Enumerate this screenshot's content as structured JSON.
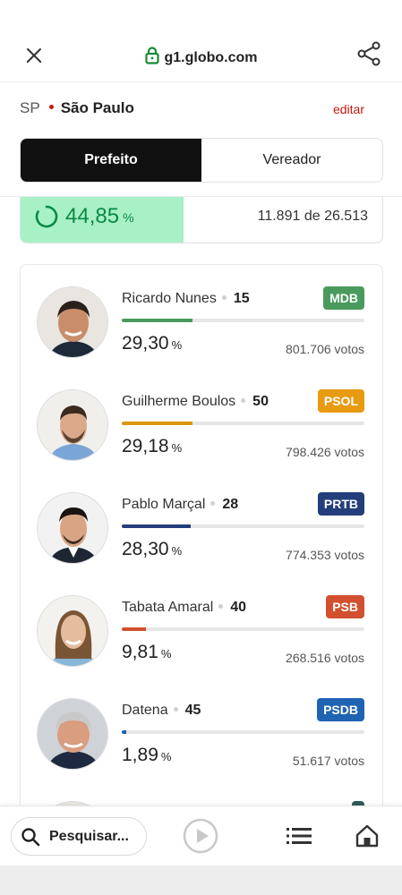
{
  "browser": {
    "url": "g1.globo.com"
  },
  "location": {
    "state": "SP",
    "city": "São Paulo",
    "edit_label": "editar"
  },
  "tabs": [
    {
      "label": "Prefeito",
      "active": true
    },
    {
      "label": "Vereador",
      "active": false
    }
  ],
  "apuracao": {
    "percent": "44,85",
    "percent_unit": "%",
    "progress_fraction": 0.4485,
    "sections": "11.891 de 26.513"
  },
  "candidates": [
    {
      "name": "Ricardo Nunes",
      "number": "15",
      "party": "MDB",
      "party_color": "#4a9a5e",
      "percent": "29,30",
      "unit": "%",
      "votes": "801.706 votos",
      "share": 0.293,
      "bar_color": "#4a9a5e"
    },
    {
      "name": "Guilherme Boulos",
      "number": "50",
      "party": "PSOL",
      "party_color": "#e89a10",
      "percent": "29,18",
      "unit": "%",
      "votes": "798.426 votos",
      "share": 0.2918,
      "bar_color": "#d9960f"
    },
    {
      "name": "Pablo Marçal",
      "number": "28",
      "party": "PRTB",
      "party_color": "#233e7a",
      "percent": "28,30",
      "unit": "%",
      "votes": "774.353 votos",
      "share": 0.283,
      "bar_color": "#233e7a"
    },
    {
      "name": "Tabata Amaral",
      "number": "40",
      "party": "PSB",
      "party_color": "#d2502f",
      "percent": "9,81",
      "unit": "%",
      "votes": "268.516 votos",
      "share": 0.0981,
      "bar_color": "#d2502f"
    },
    {
      "name": "Datena",
      "number": "45",
      "party": "PSDB",
      "party_color": "#1f63b3",
      "percent": "1,89",
      "unit": "%",
      "votes": "51.617 votos",
      "share": 0.0189,
      "bar_color": "#1f63b3"
    }
  ],
  "bottom_nav": {
    "search_label": "Pesquisar..."
  },
  "colors": {
    "accent": "#c4170c",
    "progress_green": "#0a8a45",
    "progress_fill": "#a8f0c6"
  }
}
